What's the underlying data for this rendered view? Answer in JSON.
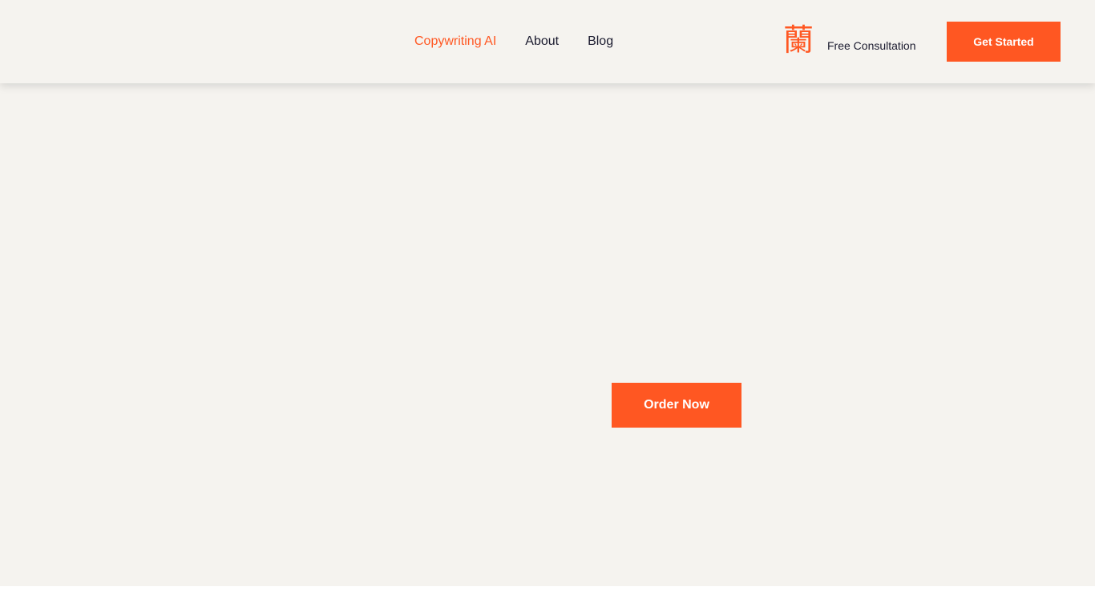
{
  "header": {
    "nav": [
      {
        "label": "Copywriting AI",
        "active": true
      },
      {
        "label": "About",
        "active": false
      },
      {
        "label": "Blog",
        "active": false
      }
    ],
    "brand_glyph": "蘭",
    "consultation_label": "Free Consultation",
    "cta_label": "Get Started"
  },
  "hero": {
    "order_label": "Order Now"
  },
  "colors": {
    "accent": "#ff5722",
    "background": "#f5f3ef",
    "text": "#1a1a2e"
  }
}
